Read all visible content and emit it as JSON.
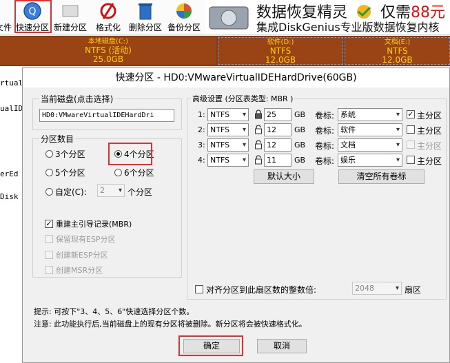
{
  "toolbar": {
    "items": [
      {
        "label": "文件"
      },
      {
        "label": "快速分区"
      },
      {
        "label": "新建分区"
      },
      {
        "label": "格式化"
      },
      {
        "label": "删除分区"
      },
      {
        "label": "备份分区"
      }
    ]
  },
  "banner": {
    "line1_prefix": "数据恢复精灵",
    "line1_mid": "仅需",
    "line1_price": "88元",
    "line2": "集成DiskGenius专业版数据恢复内核"
  },
  "diskbar": {
    "partitions": [
      {
        "name": "本地磁盘(C:)",
        "fs": "NTFS (活动)",
        "size": "25.0GB"
      },
      {
        "name": "软件(D:)",
        "fs": "NTFS",
        "size": "12.0GB"
      },
      {
        "name": "文档(E:)",
        "fs": "NTFS",
        "size": "12.0GB"
      }
    ]
  },
  "tree": {
    "lines": [
      "rtual",
      "ualID",
      "erEd",
      "Disk"
    ]
  },
  "dialog": {
    "title": "快速分区 - HD0:VMwareVirtualIDEHardDrive(60GB)",
    "current_disk_label": "当前磁盘(点击选择)",
    "current_disk_value": "HD0:VMwareVirtualIDEHardDri",
    "count_group_label": "分区数目",
    "count_options": [
      "3个分区",
      "4个分区",
      "5个分区",
      "6个分区"
    ],
    "custom_label": "自定(C):",
    "custom_value": "2",
    "custom_suffix": "个分区",
    "selected_count": "4个分区",
    "rebuild_mbr_label": "重建主引导记录(MBR)",
    "keep_esp_label": "保留现有ESP分区",
    "create_esp_label": "创建新ESP分区",
    "create_msr_label": "创建MSR分区",
    "adv_label": "高级设置 (分区表类型: MBR )",
    "rows": [
      {
        "idx": "1:",
        "fs": "NTFS",
        "size": "25",
        "unit": "GB",
        "vol_label": "卷标:",
        "vol": "系统",
        "primary": "主分区",
        "primary_checked": true,
        "primary_disabled": false
      },
      {
        "idx": "2:",
        "fs": "NTFS",
        "size": "12",
        "unit": "GB",
        "vol_label": "卷标:",
        "vol": "软件",
        "primary": "主分区",
        "primary_checked": false,
        "primary_disabled": false
      },
      {
        "idx": "3:",
        "fs": "NTFS",
        "size": "12",
        "unit": "GB",
        "vol_label": "卷标:",
        "vol": "文档",
        "primary": "主分区",
        "primary_checked": false,
        "primary_disabled": true
      },
      {
        "idx": "4:",
        "fs": "NTFS",
        "size": "11",
        "unit": "GB",
        "vol_label": "卷标:",
        "vol": "娱乐",
        "primary": "主分区",
        "primary_checked": false,
        "primary_disabled": false
      }
    ],
    "default_size_btn": "默认大小",
    "clear_labels_btn": "清空所有卷标",
    "align_label": "对齐分区到此扇区数的整数倍:",
    "align_value": "2048",
    "align_unit": "扇区",
    "tip1": "提示: 可按下\"3、4、5、6\"快速选择分区个数。",
    "tip2": "注意: 此功能执行后,当前磁盘上的现有分区将被删除。新分区将会被快速格式化。",
    "ok_btn": "确定",
    "cancel_btn": "取消"
  },
  "colors": {
    "highlight_red": "#e03030",
    "disk_bar": "#8a3a12",
    "partition_text": "#ffd200",
    "price_red": "#e01010"
  }
}
